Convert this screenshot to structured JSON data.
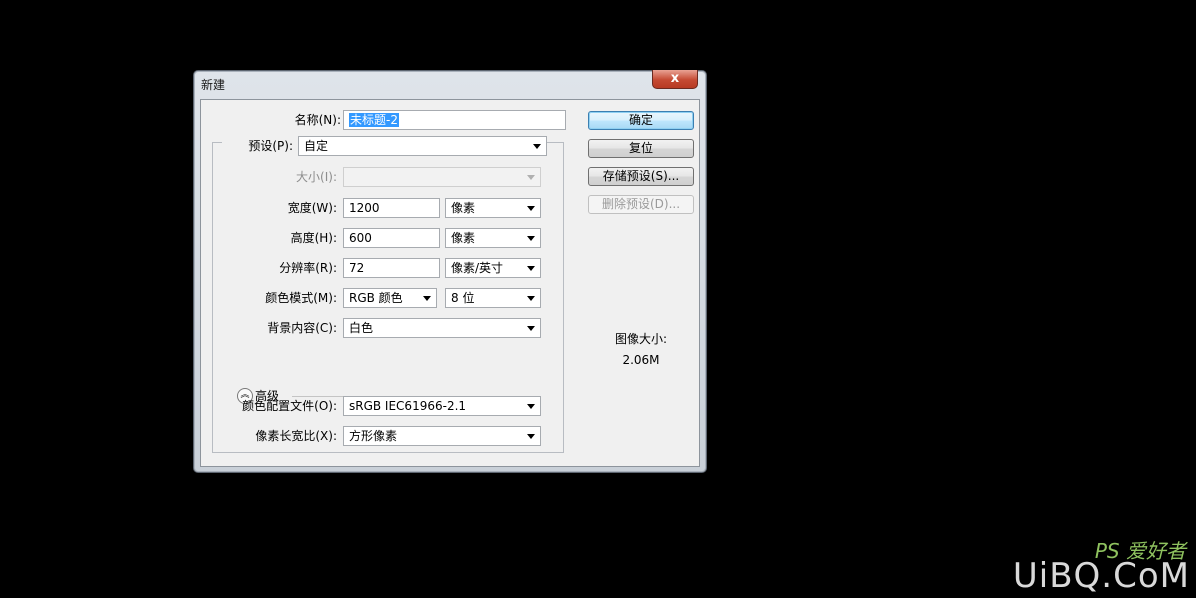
{
  "window": {
    "title": "新建",
    "close_label": "x"
  },
  "form": {
    "name": {
      "label": "名称(N):",
      "value": "未标题-2"
    },
    "preset": {
      "label": "预设(P):",
      "value": "自定"
    },
    "size": {
      "label": "大小(I):",
      "value": ""
    },
    "width": {
      "label": "宽度(W):",
      "value": "1200",
      "unit": "像素"
    },
    "height": {
      "label": "高度(H):",
      "value": "600",
      "unit": "像素"
    },
    "resolution": {
      "label": "分辨率(R):",
      "value": "72",
      "unit": "像素/英寸"
    },
    "color_mode": {
      "label": "颜色模式(M):",
      "value": "RGB 颜色",
      "depth": "8 位"
    },
    "background": {
      "label": "背景内容(C):",
      "value": "白色"
    },
    "advanced": {
      "label": "高级"
    },
    "color_profile": {
      "label": "颜色配置文件(O):",
      "value": "sRGB IEC61966-2.1"
    },
    "pixel_aspect": {
      "label": "像素长宽比(X):",
      "value": "方形像素"
    }
  },
  "buttons": {
    "ok": "确定",
    "reset": "复位",
    "save_preset": "存储预设(S)...",
    "delete_preset": "删除预设(D)..."
  },
  "image_size": {
    "label": "图像大小:",
    "value": "2.06M"
  },
  "watermark": {
    "main": "UiBQ.CoM",
    "sub": "PS 爱好者"
  }
}
